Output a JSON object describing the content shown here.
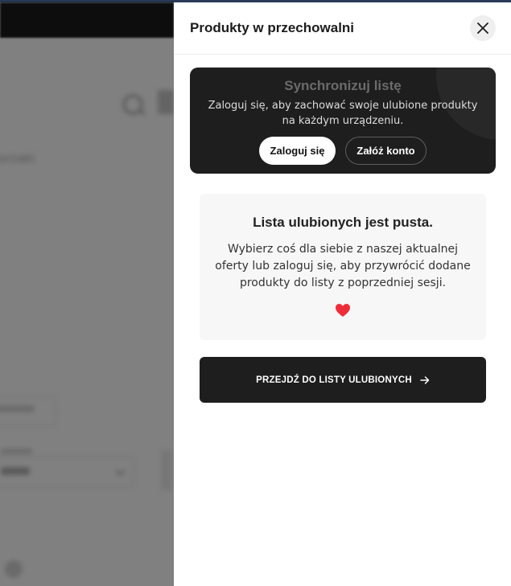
{
  "background_page": {
    "partial_text": "lorzaki"
  },
  "drawer": {
    "title": "Produkty w przechowalni",
    "close_icon": "close-icon"
  },
  "sync": {
    "title": "Synchronizuj listę",
    "description": "Zaloguj się, aby zachować swoje ulubione produkty na każdym urządzeniu.",
    "login_label": "Zaloguj się",
    "register_label": "Załóż konto"
  },
  "empty": {
    "title": "Lista ulubionych jest pusta.",
    "description": "Wybierz coś dla siebie z naszej aktualnej oferty lub zaloguj się, aby przywrócić dodane produkty do listy z poprzedniej sesji.",
    "icon": "heart-icon",
    "icon_color": "#ee2d3a"
  },
  "cta": {
    "label": "PRZEJDŹ DO LISTY ULUBIONYCH",
    "icon": "arrow-right-icon"
  },
  "colors": {
    "dark_card": "#1e1e1e",
    "overlay": "#808080",
    "accent_heart": "#ee2d3a"
  }
}
